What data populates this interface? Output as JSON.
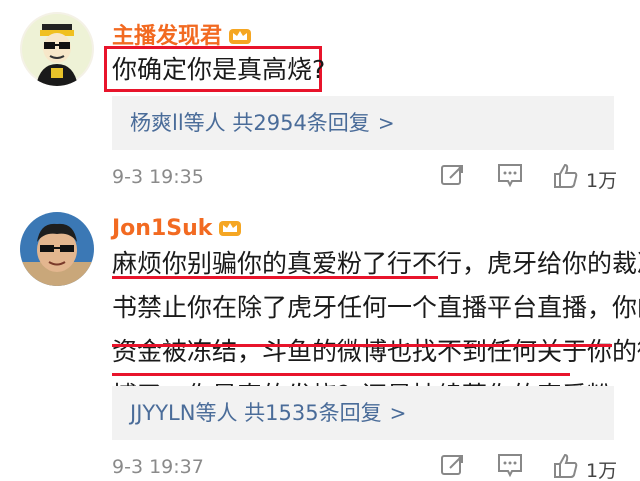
{
  "comments": [
    {
      "username": "主播发现君",
      "text_lines": [
        "你确定你是真高烧?"
      ],
      "reply_user": "杨爽ll等人",
      "reply_count": "共2954条回复",
      "time": "9-3 19:35",
      "likes": "1万"
    },
    {
      "username": "Jon1Suk",
      "text_lines": [
        "麻烦你别骗你的真爱粉了行不行，虎牙给你的裁决",
        "书禁止你在除了虎牙任何一个直播平台直播，你的",
        "资金被冻结，斗鱼的微博也找不到任何关于你的微",
        "博了，你是真的发烧？还是持续蒙你的真爱粉"
      ],
      "reply_user": "JJYYLN等人",
      "reply_count": "共1535条回复",
      "time": "9-3 19:37",
      "likes": "1万"
    }
  ],
  "icons": [
    "crown-icon",
    "share-icon",
    "comment-icon",
    "like-icon",
    "chevron-right-icon"
  ],
  "colors": {
    "username": "#f26a21",
    "reply_link": "#4a6c99",
    "highlight": "#e8142b"
  },
  "chevron": ">"
}
